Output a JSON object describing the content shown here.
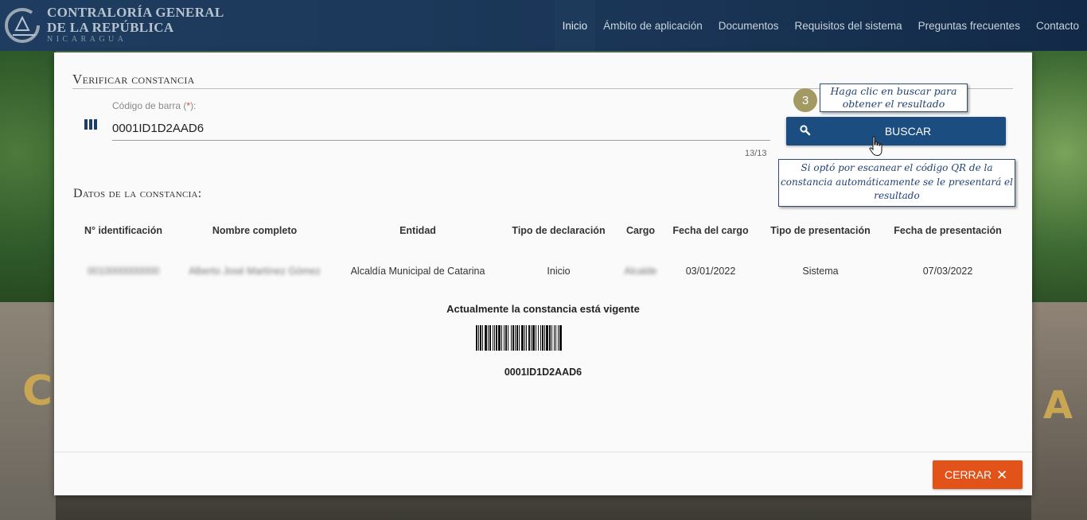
{
  "header": {
    "brand_line1": "CONTRALORÍA GENERAL",
    "brand_line2": "DE LA REPÚBLICA",
    "brand_line3": "NICARAGUA",
    "nav": [
      "Inicio",
      "Ámbito de aplicación",
      "Documentos",
      "Requisitos del sistema",
      "Preguntas frecuentes",
      "Contacto"
    ],
    "active_nav": "Inicio"
  },
  "modal": {
    "title": "Verificar constancia",
    "field_label": "Código de barra (",
    "field_required_mark": "*",
    "field_label_end": "):",
    "field_value": "0001ID1D2AAD6",
    "char_count": "13/13",
    "search_button": "BUSCAR",
    "step_number": "3",
    "callout_search": "Haga clic en buscar para obtener el resultado",
    "callout_qr": "Si optó por escanear el código QR de la constancia automáticamente se le presentará el resultado",
    "section_title": "Datos de la constancia:",
    "table": {
      "headers": [
        "N° identificación",
        "Nombre completo",
        "Entidad",
        "Tipo de declaración",
        "Cargo",
        "Fecha del cargo",
        "Tipo de presentación",
        "Fecha de presentación"
      ],
      "row": [
        "0010000000000",
        "Alberto José Martínez Gómez",
        "Alcaldía Municipal de Catarina",
        "Inicio",
        "Alcalde",
        "03/01/2022",
        "Sistema",
        "07/03/2022"
      ]
    },
    "status_text": "Actualmente la constancia está vigente",
    "barcode_text": "0001ID1D2AAD6",
    "close_button": "CERRAR",
    "close_icon": "✕"
  },
  "colors": {
    "header_bg": "#1f3d60",
    "primary": "#1b4d80",
    "close_bg": "#e2531a",
    "step_badge": "#a39a63"
  }
}
